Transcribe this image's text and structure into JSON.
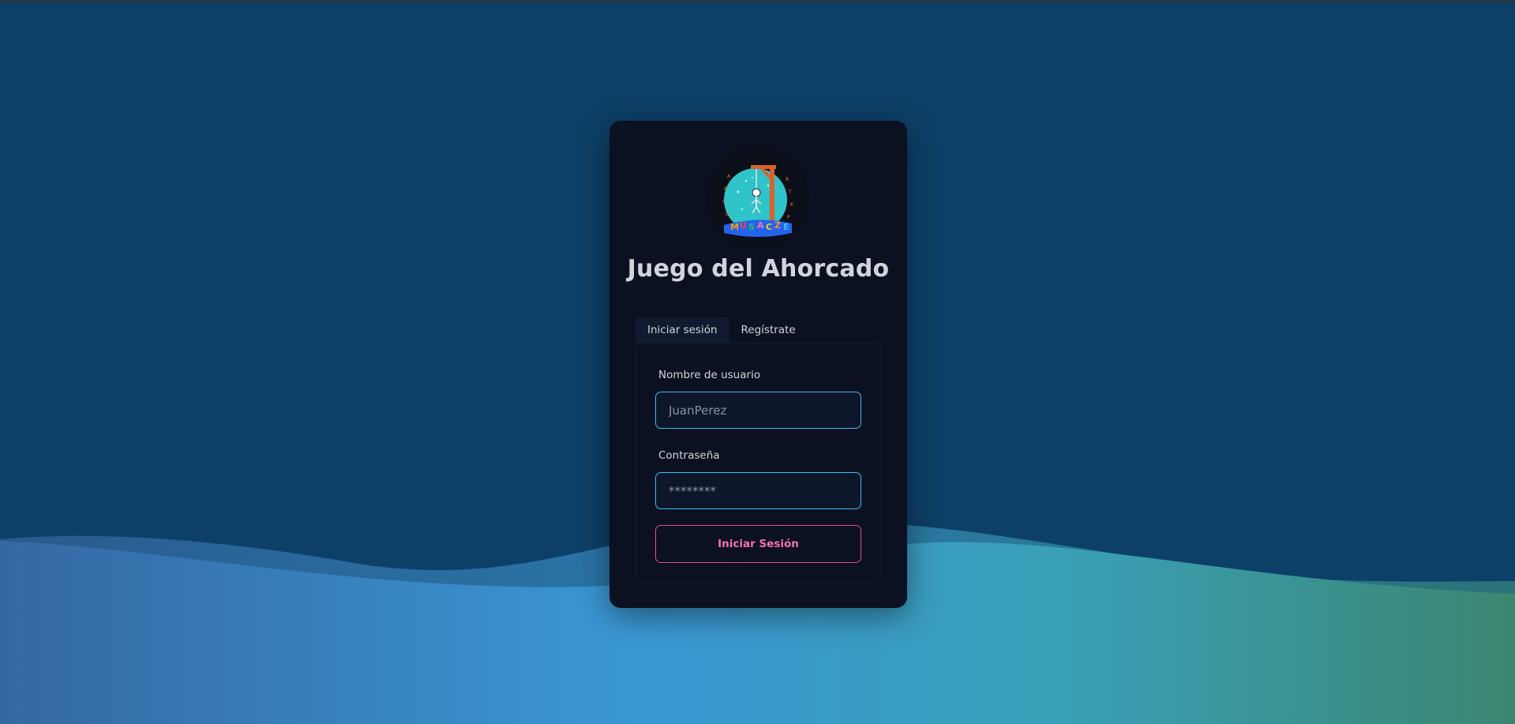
{
  "app": {
    "title": "Juego del Ahorcado"
  },
  "tabs": [
    {
      "label": "Iniciar sesión",
      "active": true
    },
    {
      "label": "Regístrate",
      "active": false
    }
  ],
  "login_form": {
    "username": {
      "label": "Nombre de usuario",
      "placeholder": "JuanPerez",
      "value": ""
    },
    "password": {
      "label": "Contraseña",
      "placeholder": "********",
      "value": ""
    },
    "submit_label": "Iniciar Sesión"
  },
  "logo": {
    "icon": "hangman-logo-icon"
  },
  "colors": {
    "background": "#0d4068",
    "card": "#0b1120",
    "input_border": "#38bdf8",
    "submit_accent": "#ec4899",
    "text": "#d1d5db"
  }
}
